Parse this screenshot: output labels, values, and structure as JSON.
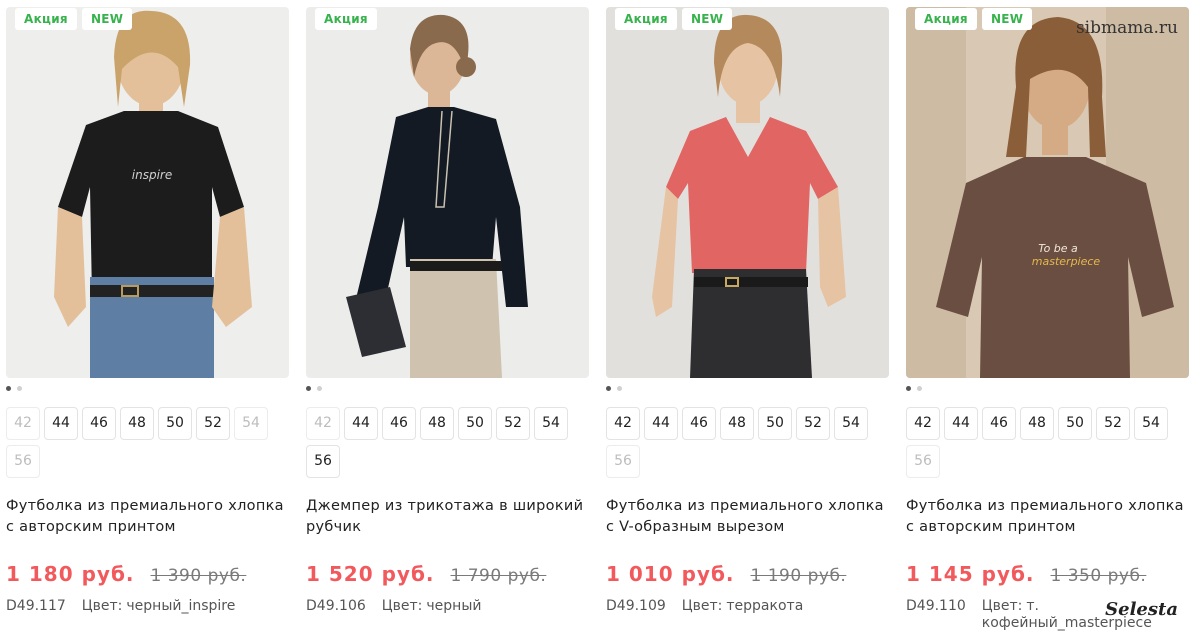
{
  "watermark": {
    "site": "sibmama.ru",
    "brand": "Selesta"
  },
  "colors": {
    "price": "#f2595c",
    "badge": "#37b24d",
    "old_price": "#7a7a7a"
  },
  "products": [
    {
      "badges": [
        "Акция",
        "NEW"
      ],
      "image_icon": "tshirt-black-photo",
      "sizes": [
        {
          "label": "42",
          "available": false
        },
        {
          "label": "44",
          "available": true
        },
        {
          "label": "46",
          "available": true
        },
        {
          "label": "48",
          "available": true
        },
        {
          "label": "50",
          "available": true
        },
        {
          "label": "52",
          "available": true
        },
        {
          "label": "54",
          "available": false
        },
        {
          "label": "56",
          "available": false
        }
      ],
      "title": "Футболка из премиального хлопка с авторским принтом",
      "price": "1 180 руб.",
      "old_price": "1 390 руб.",
      "sku": "D49.117",
      "color_label": "Цвет:",
      "color": "черный_inspire"
    },
    {
      "badges": [
        "Акция"
      ],
      "image_icon": "jumper-black-photo",
      "sizes": [
        {
          "label": "42",
          "available": false
        },
        {
          "label": "44",
          "available": true
        },
        {
          "label": "46",
          "available": true
        },
        {
          "label": "48",
          "available": true
        },
        {
          "label": "50",
          "available": true
        },
        {
          "label": "52",
          "available": true
        },
        {
          "label": "54",
          "available": true
        },
        {
          "label": "56",
          "available": true
        }
      ],
      "title": "Джемпер из трикотажа в широкий рубчик",
      "price": "1 520 руб.",
      "old_price": "1 790 руб.",
      "sku": "D49.106",
      "color_label": "Цвет:",
      "color": "черный"
    },
    {
      "badges": [
        "Акция",
        "NEW"
      ],
      "image_icon": "tshirt-terracotta-photo",
      "sizes": [
        {
          "label": "42",
          "available": true
        },
        {
          "label": "44",
          "available": true
        },
        {
          "label": "46",
          "available": true
        },
        {
          "label": "48",
          "available": true
        },
        {
          "label": "50",
          "available": true
        },
        {
          "label": "52",
          "available": true
        },
        {
          "label": "54",
          "available": true
        },
        {
          "label": "56",
          "available": false
        }
      ],
      "title": "Футболка из премиального хлопка с V-образным вырезом",
      "price": "1 010 руб.",
      "old_price": "1 190 руб.",
      "sku": "D49.109",
      "color_label": "Цвет:",
      "color": "терракота"
    },
    {
      "badges": [
        "Акция",
        "NEW"
      ],
      "image_icon": "tshirt-coffee-photo",
      "sizes": [
        {
          "label": "42",
          "available": true
        },
        {
          "label": "44",
          "available": true
        },
        {
          "label": "46",
          "available": true
        },
        {
          "label": "48",
          "available": true
        },
        {
          "label": "50",
          "available": true
        },
        {
          "label": "52",
          "available": true
        },
        {
          "label": "54",
          "available": true
        },
        {
          "label": "56",
          "available": false
        }
      ],
      "title": "Футболка из премиального хлопка с авторским принтом",
      "price": "1 145 руб.",
      "old_price": "1 350 руб.",
      "sku": "D49.110",
      "color_label": "Цвет:",
      "color": "т. кофейный_masterpiece"
    }
  ]
}
